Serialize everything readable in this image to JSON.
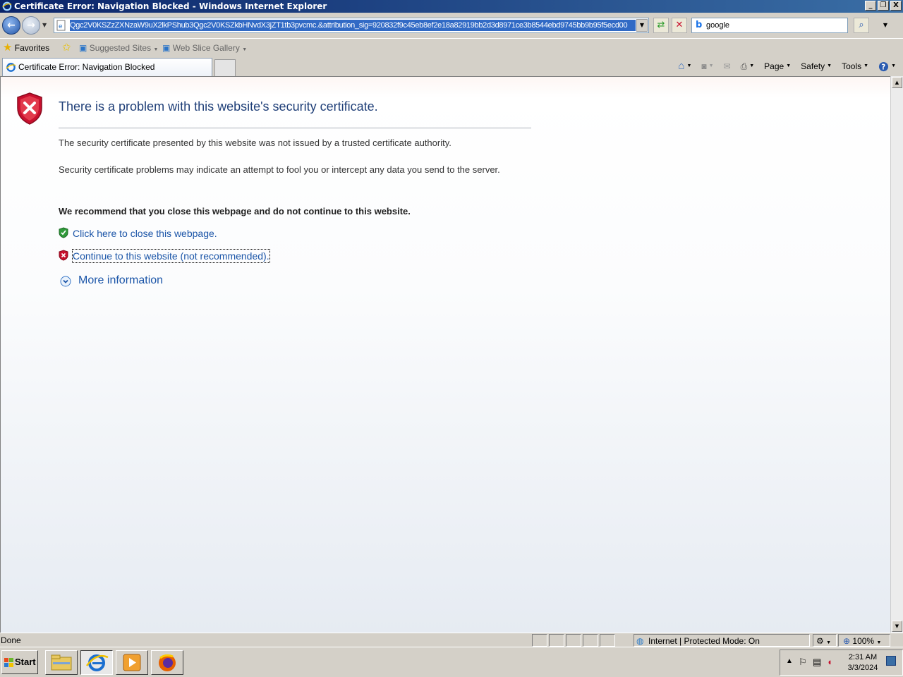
{
  "window": {
    "title": "Certificate Error: Navigation Blocked - Windows Internet Explorer",
    "buttons": [
      "_",
      "❐",
      "X"
    ]
  },
  "address_bar": {
    "url": "Qgc2V0KSZzZXNzaW9uX2lkPShub3Qgc2V0KSZkbHNvdX3jZT1tb3pvcmc.&attribution_sig=920832f9c45eb8ef2e18a82919bb2d3d8971ce3b8544ebd9745bb9b95f5ecd00"
  },
  "search": {
    "value": "google"
  },
  "favorites_bar": {
    "favorites_label": "Favorites",
    "items": [
      "Suggested Sites",
      "Web Slice Gallery"
    ]
  },
  "tab": {
    "label": "Certificate Error: Navigation Blocked"
  },
  "command_bar": {
    "page": "Page",
    "safety": "Safety",
    "tools": "Tools"
  },
  "content": {
    "heading": "There is a problem with this website's security certificate.",
    "para1": "The security certificate presented by this website was not issued by a trusted certificate authority.",
    "para2": "Security certificate problems may indicate an attempt to fool you or intercept any data you send to the server.",
    "recommend": "We recommend that you close this webpage and do not continue to this website.",
    "close_link": "Click here to close this webpage.",
    "continue_link": "Continue to this website (not recommended).",
    "more_info": "More information"
  },
  "status_bar": {
    "status": "Done",
    "zone": "Internet | Protected Mode: On",
    "zoom": "100%"
  },
  "taskbar": {
    "start": "Start",
    "time": "2:31 AM",
    "date": "3/3/2024"
  },
  "colors": {
    "title_start": "#0a246a",
    "title_end": "#3a6ea5",
    "link": "#1b55a8",
    "heading": "#1f3f78",
    "error_red": "#c8102e"
  }
}
